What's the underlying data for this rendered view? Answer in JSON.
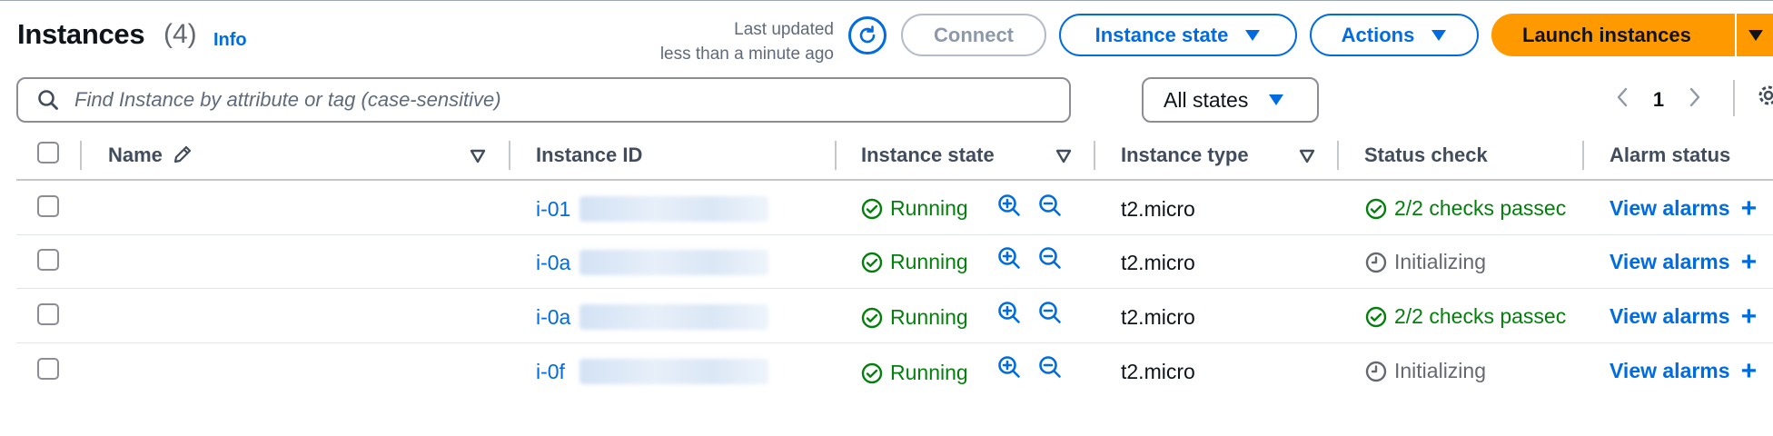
{
  "header": {
    "title": "Instances",
    "count": "(4)",
    "info": "Info",
    "last_updated_line1": "Last updated",
    "last_updated_line2": "less than a minute ago",
    "connect_label": "Connect",
    "instance_state_label": "Instance state",
    "actions_label": "Actions",
    "launch_label": "Launch instances"
  },
  "search": {
    "placeholder": "Find Instance by attribute or tag (case-sensitive)"
  },
  "filter": {
    "selected": "All states"
  },
  "pagination": {
    "current_page": "1"
  },
  "table": {
    "columns": [
      "Name",
      "Instance ID",
      "Instance state",
      "Instance type",
      "Status check",
      "Alarm status"
    ],
    "rows": [
      {
        "name": "",
        "id_prefix": "i-01",
        "state": "Running",
        "type": "t2.micro",
        "status": "2/2 checks passec",
        "status_kind": "passed",
        "alarm": "View alarms"
      },
      {
        "name": "",
        "id_prefix": "i-0a",
        "state": "Running",
        "type": "t2.micro",
        "status": "Initializing",
        "status_kind": "init",
        "alarm": "View alarms"
      },
      {
        "name": "",
        "id_prefix": "i-0a",
        "state": "Running",
        "type": "t2.micro",
        "status": "2/2 checks passec",
        "status_kind": "passed",
        "alarm": "View alarms"
      },
      {
        "name": "",
        "id_prefix": "i-0f",
        "state": "Running",
        "type": "t2.micro",
        "status": "Initializing",
        "status_kind": "init",
        "alarm": "View alarms"
      }
    ]
  },
  "colors": {
    "link": "#006ce0",
    "success": "#037f0c",
    "primary_button": "#ff9900",
    "muted": "#656871"
  }
}
